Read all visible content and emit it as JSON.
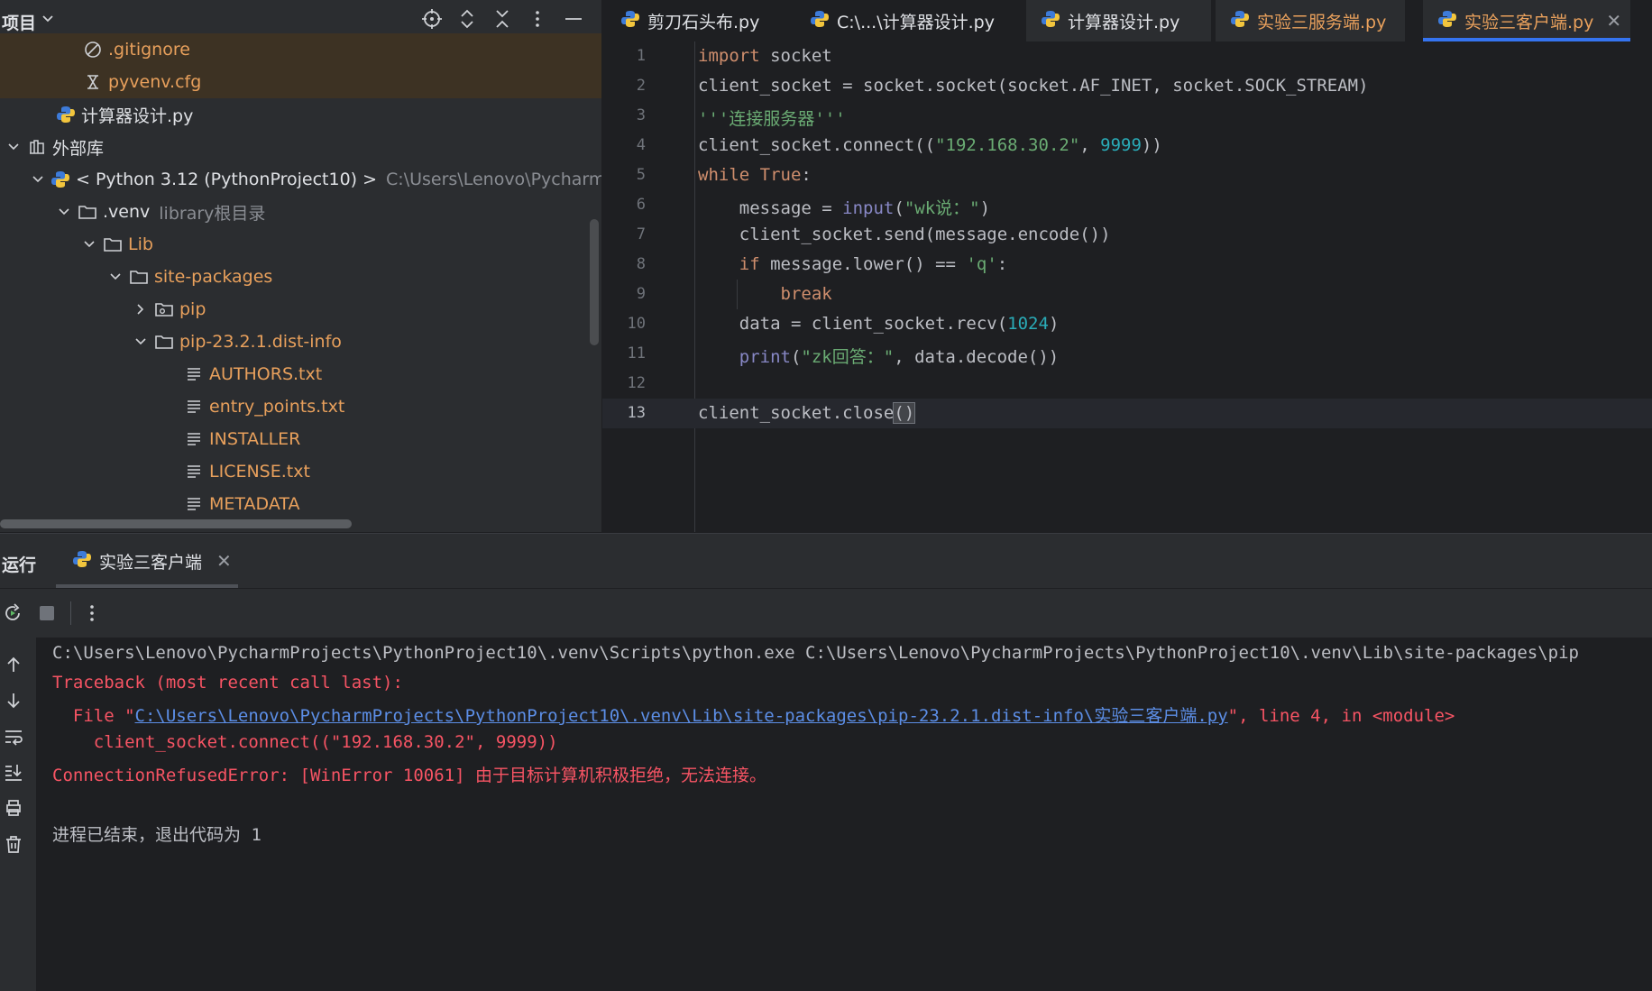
{
  "project_panel": {
    "title": "项目",
    "tree": [
      {
        "label": ".gitignore",
        "icon": "gitignore-icon",
        "excluded": true
      },
      {
        "label": "pyvenv.cfg",
        "icon": "config-file-icon",
        "excluded": true
      },
      {
        "label": "计算器设计.py",
        "icon": "python-file-icon"
      },
      {
        "label": "外部库",
        "icon": "library-icon",
        "expanded": true
      },
      {
        "label": "< Python 3.12 (PythonProject10) >",
        "hint": "C:\\Users\\Lenovo\\PycharmProjec",
        "icon": "python-sdk-icon",
        "expanded": true
      },
      {
        "label": ".venv",
        "hint": "library根目录",
        "icon": "folder-icon",
        "expanded": true
      },
      {
        "label": "Lib",
        "icon": "folder-icon",
        "expanded": true
      },
      {
        "label": "site-packages",
        "icon": "folder-icon",
        "expanded": true
      },
      {
        "label": "pip",
        "icon": "package-folder-icon",
        "expanded": false
      },
      {
        "label": "pip-23.2.1.dist-info",
        "icon": "folder-icon",
        "expanded": true
      },
      {
        "label": "AUTHORS.txt",
        "icon": "text-file-icon"
      },
      {
        "label": "entry_points.txt",
        "icon": "text-file-icon"
      },
      {
        "label": "INSTALLER",
        "icon": "text-file-icon"
      },
      {
        "label": "LICENSE.txt",
        "icon": "text-file-icon"
      },
      {
        "label": "METADATA",
        "icon": "text-file-icon"
      }
    ]
  },
  "editor": {
    "tabs": [
      {
        "label": "剪刀石头布.py"
      },
      {
        "label": "C:\\...\\计算器设计.py"
      },
      {
        "label": "计算器设计.py"
      },
      {
        "label": "实验三服务端.py"
      },
      {
        "label": "实验三客户端.py",
        "active": true
      }
    ],
    "lines": [
      {
        "n": "1",
        "tokens": [
          [
            "kw",
            "import"
          ],
          [
            "t",
            " socket"
          ]
        ]
      },
      {
        "n": "2",
        "tokens": [
          [
            "t",
            "client_socket = socket.socket(socket.AF_INET, socket.SOCK_STREAM)"
          ]
        ]
      },
      {
        "n": "3",
        "tokens": [
          [
            "str",
            "'''连接服务器'''"
          ]
        ]
      },
      {
        "n": "4",
        "tokens": [
          [
            "t",
            "client_socket.connect(("
          ],
          [
            "str",
            "\"192.168.30.2\""
          ],
          [
            "t",
            ", "
          ],
          [
            "num",
            "9999"
          ],
          [
            "t",
            "))"
          ]
        ]
      },
      {
        "n": "5",
        "tokens": [
          [
            "kw",
            "while"
          ],
          [
            "t",
            " "
          ],
          [
            "kw",
            "True"
          ],
          [
            "t",
            ":"
          ]
        ]
      },
      {
        "n": "6",
        "tokens": [
          [
            "t",
            "    message = "
          ],
          [
            "bi",
            "input"
          ],
          [
            "t",
            "("
          ],
          [
            "str",
            "\"wk说：\""
          ],
          [
            "t",
            ")"
          ]
        ]
      },
      {
        "n": "7",
        "tokens": [
          [
            "t",
            "    client_socket.send(message.encode())"
          ]
        ]
      },
      {
        "n": "8",
        "tokens": [
          [
            "t",
            "    "
          ],
          [
            "kw",
            "if"
          ],
          [
            "t",
            " message.lower() == "
          ],
          [
            "str",
            "'q'"
          ],
          [
            "t",
            ":"
          ]
        ]
      },
      {
        "n": "9",
        "tokens": [
          [
            "t",
            "        "
          ],
          [
            "kw",
            "break"
          ]
        ]
      },
      {
        "n": "10",
        "tokens": [
          [
            "t",
            "    data = client_socket.recv("
          ],
          [
            "num",
            "1024"
          ],
          [
            "t",
            ")"
          ]
        ]
      },
      {
        "n": "11",
        "tokens": [
          [
            "t",
            "    "
          ],
          [
            "bi",
            "print"
          ],
          [
            "t",
            "("
          ],
          [
            "str",
            "\"zk回答：\""
          ],
          [
            "t",
            ", data.decode())"
          ]
        ]
      },
      {
        "n": "12",
        "tokens": []
      },
      {
        "n": "13",
        "tokens": [
          [
            "t",
            "client_socket.close"
          ],
          [
            "paren",
            "()"
          ]
        ],
        "current": true
      }
    ]
  },
  "run_panel": {
    "label": "运行",
    "tab_label": "实验三客户端",
    "console": {
      "command": "C:\\Users\\Lenovo\\PycharmProjects\\PythonProject10\\.venv\\Scripts\\python.exe C:\\Users\\Lenovo\\PycharmProjects\\PythonProject10\\.venv\\Lib\\site-packages\\pip",
      "traceback_header": "Traceback (most recent call last):",
      "file_prefix": "  File \"",
      "file_link": "C:\\Users\\Lenovo\\PycharmProjects\\PythonProject10\\.venv\\Lib\\site-packages\\pip-23.2.1.dist-info\\实验三客户端.py",
      "file_suffix": "\", line 4, in <module>",
      "source_line": "    client_socket.connect((\"192.168.30.2\", 9999))",
      "error_line": "ConnectionRefusedError: [WinError 10061] 由于目标计算机积极拒绝，无法连接。",
      "exit_line": "进程已结束，退出代码为 1"
    }
  }
}
